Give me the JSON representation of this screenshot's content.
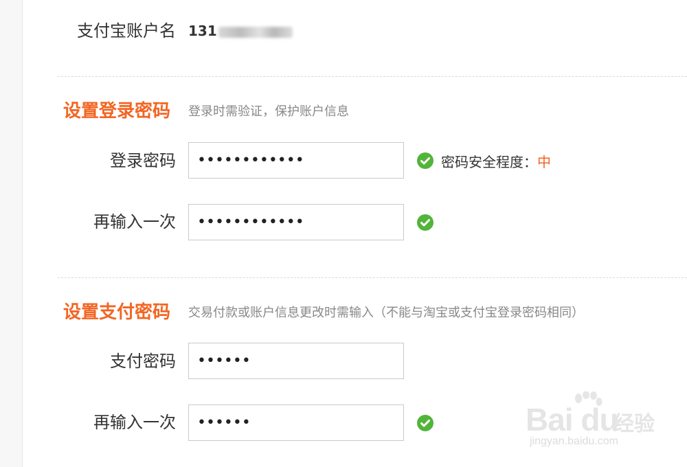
{
  "account": {
    "label": "支付宝账户名",
    "value_prefix": "131"
  },
  "login_section": {
    "title": "设置登录密码",
    "description": "登录时需验证，保护账户信息",
    "password": {
      "label": "登录密码",
      "value": "••••••••••••"
    },
    "confirm": {
      "label": "再输入一次",
      "value": "••••••••••••"
    },
    "strength": {
      "label": "密码安全程度：",
      "level": "中"
    }
  },
  "pay_section": {
    "title": "设置支付密码",
    "description": "交易付款或账户信息更改时需输入（不能与淘宝或支付宝登录密码相同）",
    "password": {
      "label": "支付密码",
      "value": "••••••"
    },
    "confirm": {
      "label": "再输入一次",
      "value": "••••••"
    }
  },
  "watermark": {
    "brand": "Bai du",
    "cn": "经验",
    "url": "jingyan.baidu.com"
  },
  "colors": {
    "accent": "#f26522",
    "check": "#52b43a"
  },
  "icons": {
    "check": "check-circle-icon"
  }
}
